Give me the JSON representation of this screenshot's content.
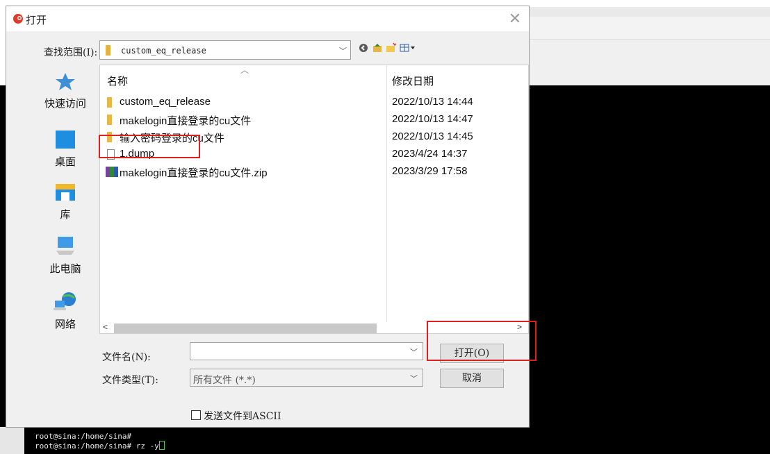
{
  "dialog": {
    "title": "打开",
    "close_glyph": "✕",
    "look_in_label": "查找范围(I):",
    "look_in_value": "custom_eq_release"
  },
  "places": [
    {
      "label": "快速访问",
      "icon": "star-icon"
    },
    {
      "label": "桌面",
      "icon": "desktop-icon"
    },
    {
      "label": "库",
      "icon": "library-icon"
    },
    {
      "label": "此电脑",
      "icon": "computer-icon"
    },
    {
      "label": "网络",
      "icon": "network-icon"
    }
  ],
  "filelist": {
    "col_name": "名称",
    "col_date": "修改日期",
    "files": [
      {
        "name": "custom_eq_release",
        "date": "2022/10/13 14:44",
        "icon": "folder-icon"
      },
      {
        "name": "makelogin直接登录的cu文件",
        "date": "2022/10/13 14:47",
        "icon": "folder-icon"
      },
      {
        "name": "输入密码登录的cu文件",
        "date": "2022/10/13 14:45",
        "icon": "folder-icon"
      },
      {
        "name": "1.dump",
        "date": "2023/4/24 14:37",
        "icon": "file-icon"
      },
      {
        "name": "makelogin直接登录的cu文件.zip",
        "date": "2023/3/29 17:58",
        "icon": "zip-icon"
      }
    ]
  },
  "form": {
    "filename_label": "文件名(N):",
    "filename_value": "",
    "filetype_label": "文件类型(T):",
    "filetype_value": "所有文件 (*.*)",
    "open_button": "打开(O)",
    "cancel_button": "取消",
    "send_ascii_label": "发送文件到ASCII"
  },
  "terminal": {
    "line1": "root@sina:/home/sina#",
    "line2": "root@sina:/home/sina# rz -y"
  },
  "colors": {
    "highlight": "#e02020",
    "folder": "#e8b645"
  }
}
